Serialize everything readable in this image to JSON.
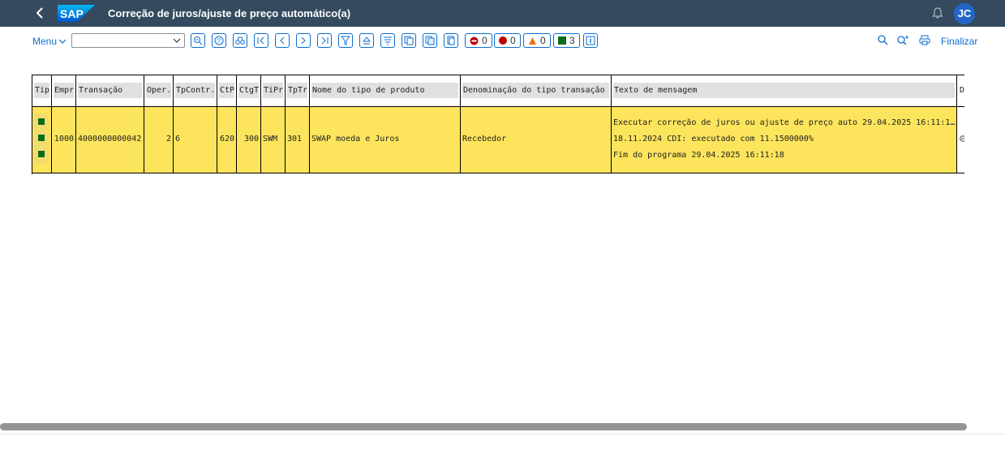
{
  "shell": {
    "title": "Correção de juros/ajuste de preço automático(a)",
    "logo_text": "SAP",
    "avatar_initials": "JC"
  },
  "toolbar": {
    "menu_label": "Menu",
    "command_value": "",
    "counters": {
      "stop": "0",
      "error": "0",
      "warning": "0",
      "success": "3"
    },
    "finalizar_label": "Finalizar"
  },
  "table": {
    "headers": {
      "tip": "Tip",
      "empr": "Empr",
      "transacao": "Transação",
      "oper": "Oper.",
      "tpcontr": "TpContr.",
      "ctp": "CtP",
      "ctgt": "CtgT",
      "tipr": "TiPr",
      "tptr": "TpTr",
      "nome": "Nome do tipo de produto",
      "denom": "Denominação do tipo transação",
      "texto": "Texto de mensagem",
      "d": "D"
    },
    "row": {
      "empr": "1000",
      "transacao": "4000000000042",
      "oper": "2",
      "tpcontr": "6",
      "ctp": "620",
      "ctgt": "300",
      "tipr": "SWM",
      "tptr": "301",
      "nome": "SWAP moeda e Juros",
      "denom": "Recebedor",
      "messages": [
        "Executar correção de juros ou ajuste de preço auto 29.04.2025 16:11:1…",
        "18.11.2024 CDI: executado com 11.1500000%",
        "Fim do programa 29.04.2025 16:11:18"
      ]
    }
  },
  "colors": {
    "shell_bg": "#354a5f",
    "accent": "#0a6ed1",
    "row_highlight": "#fce45c",
    "success": "#0b6b1d",
    "error": "#bb0000",
    "warning": "#e9730c"
  }
}
